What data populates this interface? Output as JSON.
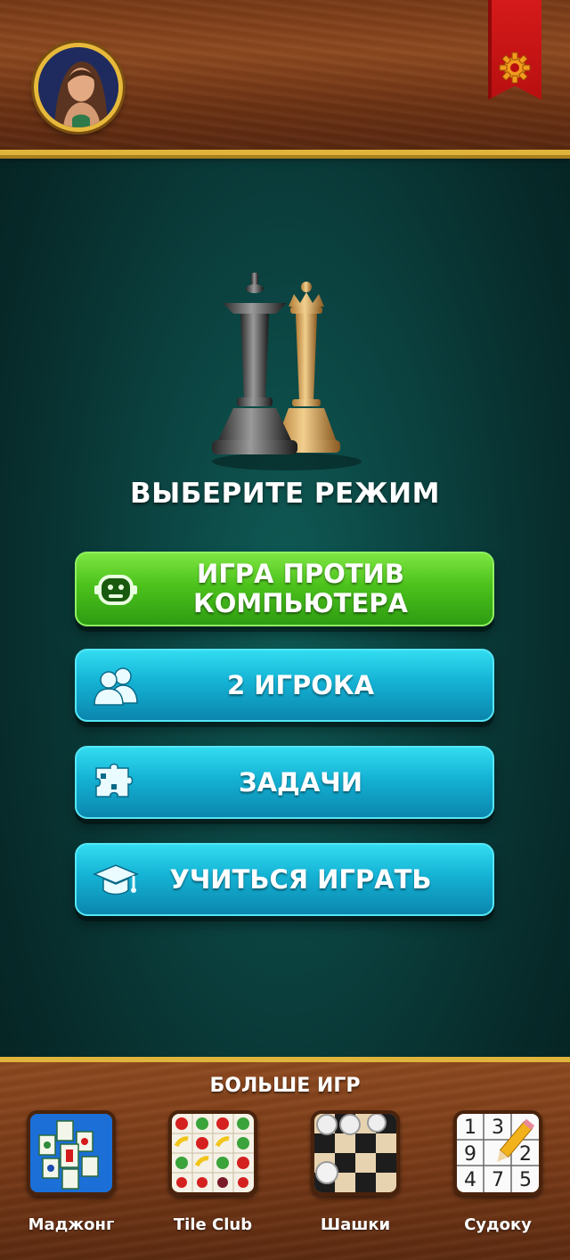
{
  "header": {
    "avatar_icon": "player-avatar",
    "settings_icon": "gear-icon",
    "accent_color": "#e0b43a",
    "flag_color": "#d51a1a"
  },
  "main": {
    "title": "ВЫБЕРИТЕ РЕЖИМ",
    "buttons": [
      {
        "label_line1": "ИГРА ПРОТИВ",
        "label_line2": "КОМПЬЮТЕРА",
        "icon": "robot-icon",
        "color": "#4cc21c"
      },
      {
        "label": "2 ИГРОКА",
        "icon": "users-icon",
        "color": "#14b2d4"
      },
      {
        "label": "ЗАДАЧИ",
        "icon": "puzzle-icon",
        "color": "#14b2d4"
      },
      {
        "label": "УЧИТЬСЯ ИГРАТЬ",
        "icon": "graduation-cap-icon",
        "color": "#14b2d4"
      }
    ]
  },
  "footer": {
    "title": "БОЛЬШЕ ИГР",
    "games": [
      {
        "label": "Маджонг",
        "icon": "mahjong-icon"
      },
      {
        "label": "Tile Club",
        "icon": "tile-club-icon"
      },
      {
        "label": "Шашки",
        "icon": "checkers-icon"
      },
      {
        "label": "Судоку",
        "icon": "sudoku-icon"
      }
    ],
    "sudoku_digits": [
      "1",
      "3",
      "9",
      "2",
      "4",
      "7",
      "5"
    ]
  }
}
